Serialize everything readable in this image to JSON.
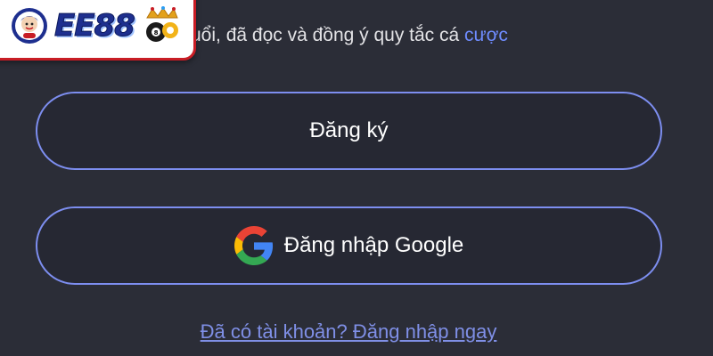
{
  "brand": {
    "logo_text": "EE88",
    "colors": {
      "badge_border": "#c81d25",
      "logo_text": "#1e2f8f",
      "mascot": "mascot-icon",
      "deco": "crown-ball-icon"
    }
  },
  "terms": {
    "text": "uổi, đã đọc và đồng ý quy tắc cá",
    "link_label": "cược"
  },
  "buttons": {
    "register_label": "Đăng ký",
    "google_label": "Đăng nhập Google",
    "google_icon": "google-icon"
  },
  "login": {
    "link_label": "Đã có tài khoản? Đăng nhập ngay"
  },
  "theme": {
    "background": "#2b2d37",
    "button_border": "#7d8ef0",
    "link_color": "#6f8cff"
  }
}
